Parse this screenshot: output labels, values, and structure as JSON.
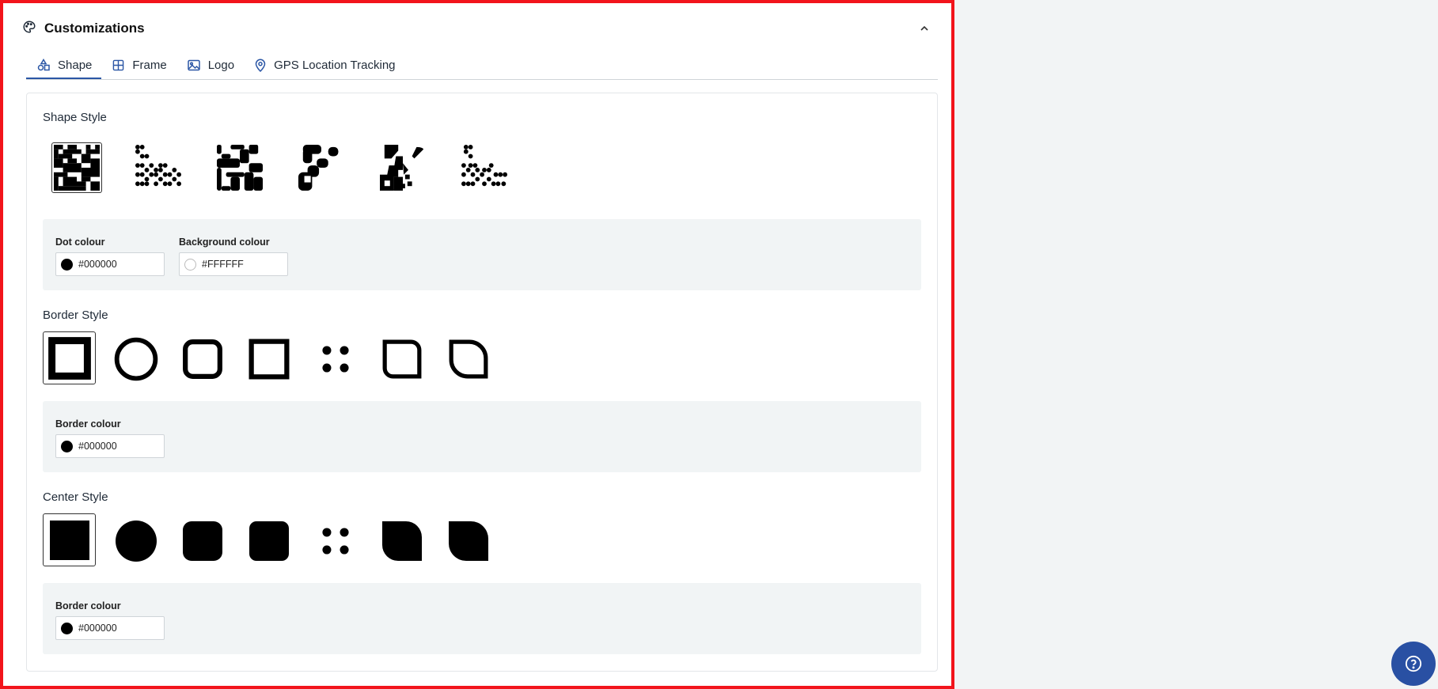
{
  "header": {
    "title": "Customizations"
  },
  "tabs": [
    {
      "label": "Shape",
      "icon": "shapes-icon"
    },
    {
      "label": "Frame",
      "icon": "grid-icon"
    },
    {
      "label": "Logo",
      "icon": "image-icon"
    },
    {
      "label": "GPS Location Tracking",
      "icon": "map-pin-icon"
    }
  ],
  "shape": {
    "title": "Shape Style",
    "dot_colour_label": "Dot colour",
    "dot_colour": "#000000",
    "background_colour_label": "Background colour",
    "background_colour": "#FFFFFF"
  },
  "border": {
    "title": "Border Style",
    "colour_label": "Border colour",
    "colour": "#000000"
  },
  "center": {
    "title": "Center Style",
    "colour_label": "Border colour",
    "colour": "#000000"
  },
  "colors": {
    "accent": "#2b56a5",
    "help_button": "#2950a3",
    "frame": "#f2141b"
  }
}
